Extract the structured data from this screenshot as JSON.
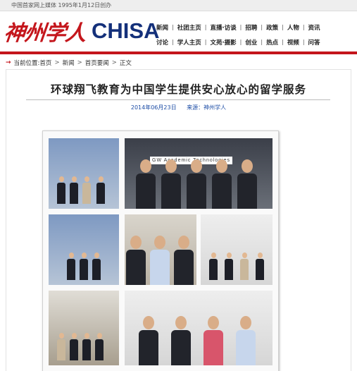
{
  "topbar": {
    "text": "中国首家网上媒体 1995年1月12日创办"
  },
  "logo": {
    "chinese": "神州学人",
    "english": "CHISA"
  },
  "nav": {
    "row1": [
      "新闻",
      "社团主页",
      "直播·访谈",
      "招聘",
      "政策",
      "人物",
      "资讯"
    ],
    "row2": [
      "讨论",
      "学人主页",
      "文苑·摄影",
      "创业",
      "热点",
      "视频",
      "问答"
    ]
  },
  "breadcrumb": {
    "prefix": "当前位置:",
    "items": [
      "首页",
      "新闻",
      "首页要闻",
      "正文"
    ]
  },
  "article": {
    "title": "环球翔飞教育为中国学生提供安心放心的留学服务",
    "date": "2014年06月23日",
    "source": "来源：神州学人"
  },
  "collage": {
    "sign_text": "GW  Academic Technologies"
  },
  "colors": {
    "brand_red": "#c4161c",
    "brand_blue": "#14307a",
    "link_blue": "#1e4ea6"
  }
}
